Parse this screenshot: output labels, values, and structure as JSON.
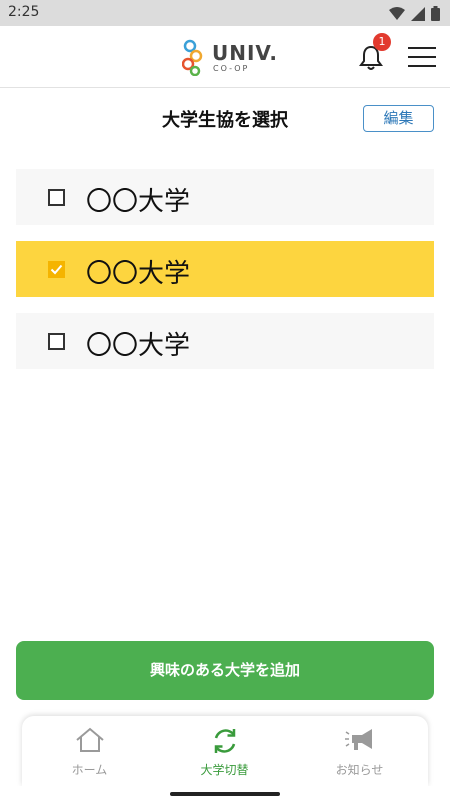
{
  "status_bar": {
    "time": "2:25",
    "icons": [
      "wifi-icon",
      "signal-icon",
      "battery-icon"
    ]
  },
  "header": {
    "logo_text": "UNIV.",
    "logo_subtext": "CO-OP",
    "notification_count": "1",
    "icons": [
      "bell-icon",
      "hamburger-menu-icon"
    ]
  },
  "page": {
    "title": "大学生協を選択",
    "edit_label": "編集"
  },
  "universities": [
    {
      "name": "〇〇大学",
      "checked": false
    },
    {
      "name": "〇〇大学",
      "checked": true
    },
    {
      "name": "〇〇大学",
      "checked": false
    }
  ],
  "add_button_label": "興味のある大学を追加",
  "bottom_nav": [
    {
      "label": "ホーム",
      "icon": "home-icon",
      "active": false
    },
    {
      "label": "大学切替",
      "icon": "refresh-icon",
      "active": true
    },
    {
      "label": "お知らせ",
      "icon": "megaphone-icon",
      "active": false
    }
  ],
  "colors": {
    "selected_row": "#fdd53f",
    "checkbox_checked": "#f5b400",
    "add_button": "#4caf50",
    "active_nav": "#3a9b3c",
    "badge": "#e23a2e",
    "edit_border": "#4a90c8"
  }
}
